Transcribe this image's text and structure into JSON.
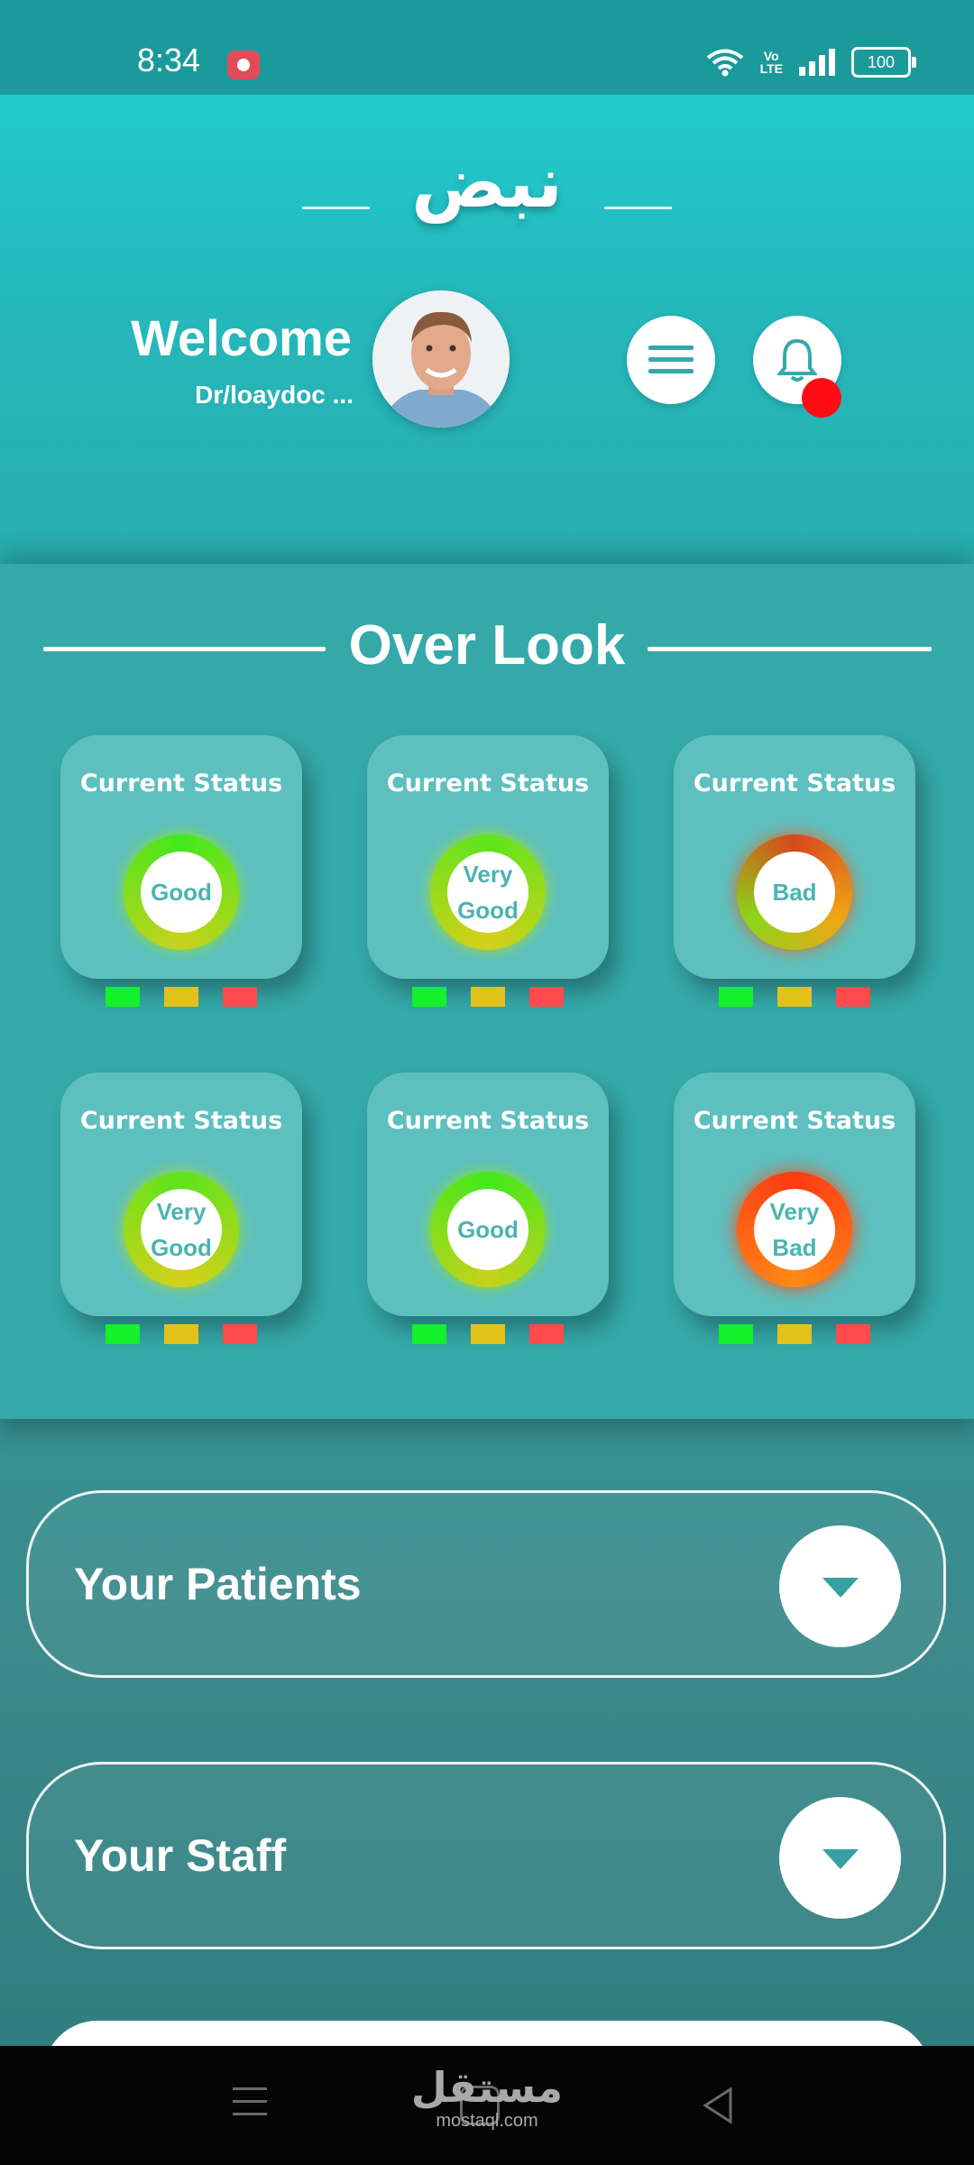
{
  "status_bar": {
    "time": "8:34",
    "volte_top": "Vo",
    "volte_bottom": "LTE",
    "battery": "100",
    "icons": [
      "screen-record-icon",
      "wifi-icon",
      "volte-icon",
      "signal-icon",
      "battery-icon"
    ]
  },
  "header": {
    "logo_text": "نبض",
    "welcome": "Welcome",
    "username": "Dr/loaydoc ...",
    "menu_icon": "hamburger-icon",
    "notification_icon": "bell-icon"
  },
  "overlook": {
    "title": "Over Look",
    "legend_colors": {
      "good": "#12f12a",
      "medium": "#e2c219",
      "bad": "#ff4b4b"
    },
    "cards": [
      {
        "title": "Current Status",
        "lines": [
          "Good"
        ],
        "level": "good"
      },
      {
        "title": "Current Status",
        "lines": [
          "Very",
          "Good"
        ],
        "level": "very-good"
      },
      {
        "title": "Current Status",
        "lines": [
          "Bad"
        ],
        "level": "bad"
      },
      {
        "title": "Current Status",
        "lines": [
          "Very",
          "Good"
        ],
        "level": "very-good"
      },
      {
        "title": "Current Status",
        "lines": [
          "Good"
        ],
        "level": "good"
      },
      {
        "title": "Current Status",
        "lines": [
          "Very",
          "Bad"
        ],
        "level": "very-bad"
      }
    ]
  },
  "sections": [
    {
      "label": "Your Patients",
      "icon": "chevron-down-icon"
    },
    {
      "label": "Your Staff",
      "icon": "chevron-down-icon"
    }
  ],
  "navigation_bar": {
    "watermark_ar": "مستقل",
    "watermark_en": "mostaql.com",
    "icons": [
      "recent-apps-icon",
      "home-icon",
      "back-icon"
    ]
  }
}
